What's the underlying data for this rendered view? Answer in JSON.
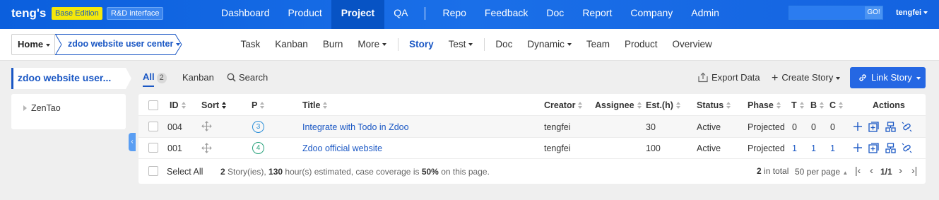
{
  "topbar": {
    "brand": "teng's",
    "edition_badge": "Base Edition",
    "interface_badge": "R&D interface",
    "nav_items": [
      "Dashboard",
      "Product",
      "Project",
      "QA",
      "Repo",
      "Feedback",
      "Doc",
      "Report",
      "Company",
      "Admin"
    ],
    "active_nav": "Project",
    "search_button": "GO!",
    "user": "tengfei"
  },
  "subbar": {
    "home": "Home",
    "project": "zdoo website user center",
    "items": [
      "Task",
      "Kanban",
      "Burn",
      "More",
      "Story",
      "Test",
      "Doc",
      "Dynamic",
      "Team",
      "Product",
      "Overview"
    ],
    "active": "Story"
  },
  "sidebar": {
    "title": "zdoo website user...",
    "tree_item": "ZenTao"
  },
  "toolbar": {
    "all_label": "All",
    "all_count": "2",
    "kanban_label": "Kanban",
    "search_label": "Search",
    "export_label": "Export Data",
    "create_label": "Create Story",
    "link_label": "Link Story"
  },
  "table": {
    "headers": {
      "id": "ID",
      "sort": "Sort",
      "p": "P",
      "title": "Title",
      "creator": "Creator",
      "assignee": "Assignee",
      "est": "Est.(h)",
      "status": "Status",
      "phase": "Phase",
      "t": "T",
      "b": "B",
      "c": "C",
      "actions": "Actions"
    },
    "rows": [
      {
        "id": "004",
        "p": "3",
        "title": "Integrate with Todo in Zdoo",
        "creator": "tengfei",
        "assignee": "",
        "est": "30",
        "status": "Active",
        "phase": "Projected",
        "t": "0",
        "b": "0",
        "c": "0"
      },
      {
        "id": "001",
        "p": "4",
        "title": "Zdoo official website",
        "creator": "tengfei",
        "assignee": "",
        "est": "100",
        "status": "Active",
        "phase": "Projected",
        "t": "1",
        "b": "1",
        "c": "1"
      }
    ]
  },
  "footer": {
    "select_all": "Select All",
    "summary_count": "2",
    "summary_mid1": " Story(ies), ",
    "summary_hours": "130",
    "summary_mid2": " hour(s) estimated, case coverage is ",
    "summary_coverage": "50%",
    "summary_end": " on this page.",
    "total_count": "2",
    "total_label": " in total",
    "per_page": "50 per page",
    "page": "1/1"
  },
  "colors": {
    "topbar": "#1463e0",
    "accent": "#1a57c4",
    "button": "#2567e3",
    "badge": "#f5e80a"
  }
}
